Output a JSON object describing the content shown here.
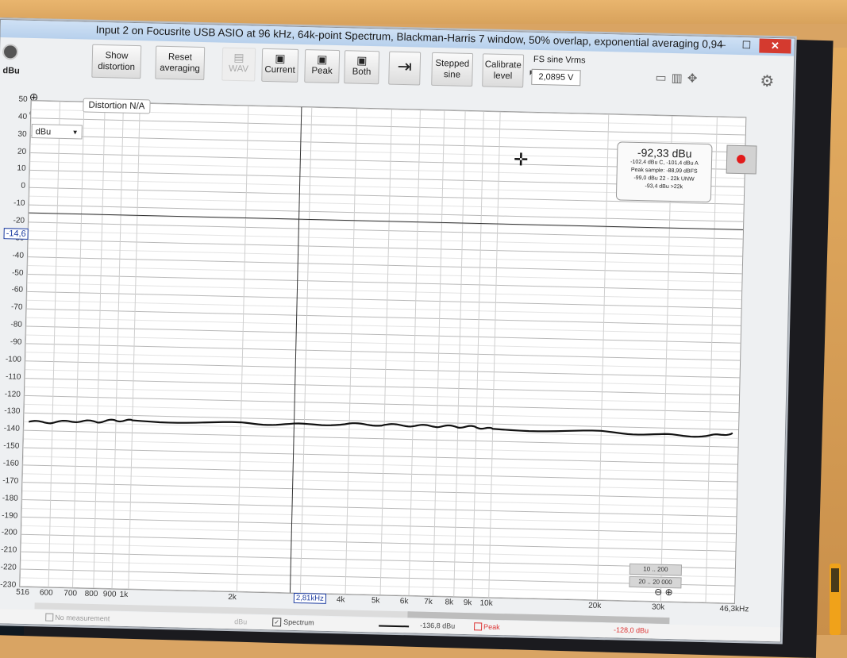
{
  "window": {
    "title": "Input 2 on Focusrite USB ASIO at 96 kHz, 64k-point Spectrum, Blackman-Harris 7 window, 50% overlap, exponential averaging 0,94",
    "minimize": "–",
    "maximize": "☐",
    "close": "✕"
  },
  "toolbar": {
    "unit_corner": "dBu",
    "show_distortion_1": "Show",
    "show_distortion_2": "distortion",
    "reset_averaging_1": "Reset",
    "reset_averaging_2": "averaging",
    "wav": "WAV",
    "current": "Current",
    "peak": "Peak",
    "both": "Both",
    "stepped_sine_1": "Stepped",
    "stepped_sine_2": "sine",
    "calibrate_level_1": "Calibrate",
    "calibrate_level_2": "level",
    "fs_sine_label": "FS sine Vrms",
    "fs_sine_value": "2,0895 V"
  },
  "plot": {
    "unit_select": "dBu",
    "distortion": "Distortion N/A",
    "cursor_y_value": "-14,6",
    "cursor_x_value": "2,81kHz",
    "readout": {
      "main": "-92,33 dBu",
      "line1": "-102,4 dBu C, -101,4 dBu A",
      "line2": "Peak sample: -88,99 dBFS",
      "line3": "-99,0 dBu 22 - 22k UNW",
      "line4": "-93,4 dBu >22k"
    },
    "range_a": "10 .. 200",
    "range_b": "20 .. 20 000"
  },
  "status": {
    "no_measurement": "No measurement",
    "dbu_label": "dBu",
    "spectrum_label": "Spectrum",
    "spectrum_value": "-136,8 dBu",
    "peak_label": "Peak",
    "peak_value": "-128,0 dBu"
  },
  "colors": {
    "trace": "#111111",
    "accent_blue": "#1a3aa0",
    "record_red": "#e21b1b",
    "close_red": "#d43a2f"
  },
  "chart_data": {
    "type": "line",
    "title": "",
    "xlabel": "",
    "ylabel": "dBu",
    "x_scale": "log",
    "xlim": [
      500,
      48000
    ],
    "ylim": [
      -230,
      50
    ],
    "y_ticks": [
      "50",
      "40",
      "30",
      "20",
      "10",
      "0",
      "-10",
      "-20",
      "-30",
      "-40",
      "-50",
      "-60",
      "-70",
      "-80",
      "-90",
      "-100",
      "-110",
      "-120",
      "-130",
      "-140",
      "-150",
      "-160",
      "-170",
      "-180",
      "-190",
      "-200",
      "-210",
      "-220",
      "-230"
    ],
    "x_ticks": [
      "516",
      "600",
      "700",
      "800",
      "900",
      "1k",
      "2k",
      "4k",
      "5k",
      "6k",
      "7k",
      "8k",
      "9k",
      "10k",
      "20k",
      "30k",
      "46,3kHz"
    ],
    "x_tick_values": [
      516,
      600,
      700,
      800,
      900,
      1000,
      2000,
      4000,
      5000,
      6000,
      7000,
      8000,
      9000,
      10000,
      20000,
      30000,
      46300
    ],
    "grid": true,
    "series": [
      {
        "name": "Spectrum",
        "x": [
          516,
          600,
          700,
          800,
          900,
          1000,
          2000,
          2810,
          4000,
          5000,
          6000,
          7000,
          8000,
          9000,
          10000,
          20000,
          30000,
          40000,
          46300
        ],
        "y": [
          -135,
          -135,
          -134,
          -134,
          -133,
          -133,
          -133,
          -133,
          -132,
          -132,
          -132,
          -132,
          -132,
          -132,
          -133,
          -133,
          -134,
          -134,
          -132
        ]
      }
    ]
  }
}
